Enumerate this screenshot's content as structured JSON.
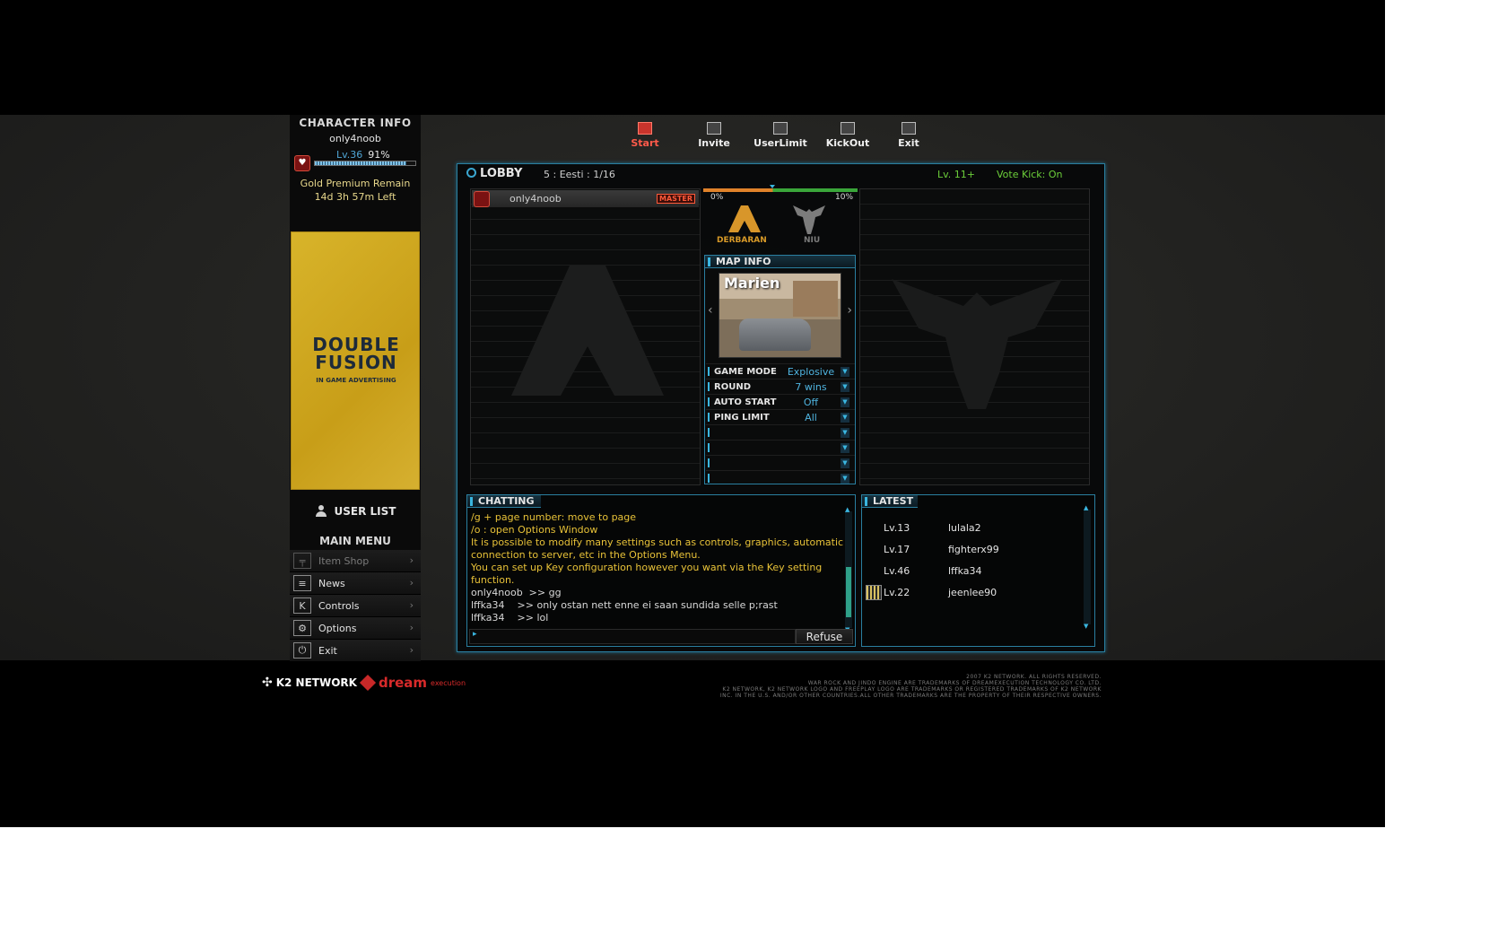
{
  "character_info": {
    "title": "CHARACTER INFO",
    "name": "only4noob",
    "level": "Lv.36",
    "exp_percent": "91%",
    "exp_fraction": 0.91,
    "premium_line1": "Gold Premium Remain",
    "premium_line2": "14d  3h 57m Left"
  },
  "ad": {
    "brand_line1": "DOUBLE",
    "brand_line2": "FUSION",
    "tagline": "IN GAME ADVERTISING"
  },
  "user_list_label": "USER LIST",
  "main_menu": {
    "title": "MAIN MENU",
    "items": [
      {
        "label": "Item Shop",
        "icon": "gun-icon",
        "glyph": "╤",
        "enabled": false
      },
      {
        "label": "News",
        "icon": "news-icon",
        "glyph": "≡",
        "enabled": true
      },
      {
        "label": "Controls",
        "icon": "controls-icon",
        "glyph": "K",
        "enabled": true
      },
      {
        "label": "Options",
        "icon": "gear-icon",
        "glyph": "⚙",
        "enabled": true
      },
      {
        "label": "Exit",
        "icon": "power-icon",
        "glyph": "⏻",
        "enabled": true
      }
    ]
  },
  "toolbar": {
    "start": "Start",
    "invite": "Invite",
    "userlimit": "UserLimit",
    "kickout": "KickOut",
    "exit": "Exit"
  },
  "lobby": {
    "title": "LOBBY",
    "room": "5 : Eesti : 1/16",
    "level_req": "Lv. 11+",
    "vote_kick": "Vote Kick: On",
    "player": {
      "name": "only4noob",
      "badge": "MASTER"
    },
    "score_left": "0%",
    "score_right": "10%",
    "team_left": "DERBARAN",
    "team_right": "NIU"
  },
  "map_info": {
    "title": "MAP INFO",
    "map_name": "Marien",
    "options": [
      {
        "label": "GAME MODE",
        "value": "Explosive"
      },
      {
        "label": "ROUND",
        "value": "7 wins"
      },
      {
        "label": "AUTO START",
        "value": "Off"
      },
      {
        "label": "PING LIMIT",
        "value": "All"
      }
    ]
  },
  "chat": {
    "title": "CHATTING",
    "lines": [
      {
        "text": "/g + page number: move to page",
        "type": "sys"
      },
      {
        "text": "/o : open Options Window",
        "type": "sys"
      },
      {
        "text": "It is possible to modify many settings such as controls, graphics, automatic",
        "type": "sys"
      },
      {
        "text": "connection to server, etc in the Options Menu.",
        "type": "sys"
      },
      {
        "text": "You can set up Key configuration however you want via the Key setting",
        "type": "sys"
      },
      {
        "text": "function.",
        "type": "sys"
      },
      {
        "text": "only4noob  >> gg",
        "type": "user"
      },
      {
        "text": "lffka34    >> only ostan nett enne ei saan sundida selle p;rast",
        "type": "user"
      },
      {
        "text": "lffka34    >> lol",
        "type": "user"
      }
    ],
    "refuse": "Refuse"
  },
  "latest": {
    "title": "LATEST",
    "players": [
      {
        "level": "Lv.13",
        "name": "lulala2",
        "emblem": false
      },
      {
        "level": "Lv.17",
        "name": "fighterx99",
        "emblem": false
      },
      {
        "level": "Lv.46",
        "name": "lffka34",
        "emblem": false
      },
      {
        "level": "Lv.22",
        "name": "jeenlee90",
        "emblem": true
      }
    ]
  },
  "footer": {
    "k2": "K2 NETWORK",
    "dream": "dream",
    "execution": "execution",
    "copyright": [
      "2007 K2 NETWORK. ALL RIGHTS RESERVED.",
      "WAR ROCK AND JINDO ENGINE ARE TRADEMARKS OF DREAMEXECUTION TECHNOLOGY CO. LTD.",
      "K2 NETWORK, K2 NETWORK LOGO AND FREEPLAY LOGO ARE TRADEMARKS OR REGISTERED TRADEMARKS OF K2 NETWORK",
      "INC. IN THE U.S. AND/OR OTHER COUNTRIES.ALL OTHER TRADEMARKS ARE THE PROPERTY OF THEIR RESPECTIVE OWNERS."
    ]
  }
}
